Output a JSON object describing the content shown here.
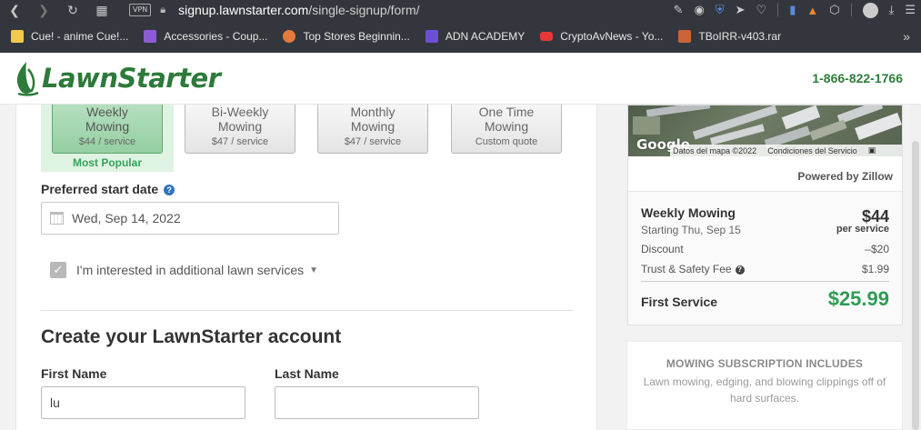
{
  "browser": {
    "vpn": "VPN",
    "url_domain": "signup.lawnstarter.com",
    "url_path": "/single-signup/form/",
    "bookmarks": [
      {
        "label": "Cue! - anime Cue!...",
        "color": "#f2c94c"
      },
      {
        "label": "Accessories - Coup...",
        "color": "#8e5bd6"
      },
      {
        "label": "Top Stores Beginnin...",
        "color": "#e27b3a"
      },
      {
        "label": "ADN ACADEMY",
        "color": "#6b4fd8"
      },
      {
        "label": "CryptoAvNews - Yo...",
        "color": "#e53935"
      },
      {
        "label": "TBoIRR-v403.rar",
        "color": "#c9643b"
      }
    ]
  },
  "header": {
    "logo_text": "LawnStarter",
    "phone": "1-866-822-1766"
  },
  "frequency": {
    "options": [
      {
        "name_line1": "Weekly",
        "name_line2": "Mowing",
        "price": "$44 / service",
        "selected": true
      },
      {
        "name_line1": "Bi-Weekly",
        "name_line2": "Mowing",
        "price": "$47 / service",
        "selected": false
      },
      {
        "name_line1": "Monthly",
        "name_line2": "Mowing",
        "price": "$47 / service",
        "selected": false
      },
      {
        "name_line1": "One Time",
        "name_line2": "Mowing",
        "price": "Custom quote",
        "selected": false
      }
    ],
    "badge": "Most Popular"
  },
  "start_date": {
    "label": "Preferred start date",
    "value": "Wed, Sep 14, 2022"
  },
  "additional": {
    "label": "I'm interested in additional lawn services",
    "checked": true
  },
  "account": {
    "title": "Create your LawnStarter account",
    "first_name_label": "First Name",
    "first_name_value": "lu",
    "last_name_label": "Last Name",
    "last_name_value": ""
  },
  "map": {
    "brand": "Google",
    "data_text": "Datos del mapa ©2022",
    "terms_text": "Condiciones del Servicio"
  },
  "summary": {
    "powered_by": "Powered by Zillow",
    "service": "Weekly Mowing",
    "amount": "$44",
    "starting": "Starting Thu, Sep 15",
    "per_service": "per service",
    "discount_label": "Discount",
    "discount_value": "–$20",
    "fee_label": "Trust & Safety Fee",
    "fee_value": "$1.99",
    "first_label": "First Service",
    "first_value": "$25.99"
  },
  "includes": {
    "title": "MOWING SUBSCRIPTION INCLUDES",
    "text": "Lawn mowing, edging, and blowing clippings off of hard surfaces."
  }
}
